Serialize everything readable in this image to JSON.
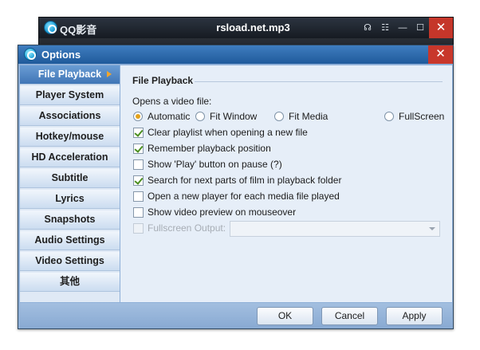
{
  "player": {
    "app_name": "QQ影音",
    "file_name": "rsload.net.mp3",
    "controls": [
      "chat-icon",
      "playlist-icon",
      "minimize-icon",
      "maximize-icon",
      "close-icon"
    ],
    "control_glyphs": [
      "☊",
      "☷",
      "—",
      "☐",
      "✕"
    ]
  },
  "dialog": {
    "title": "Options",
    "close_glyph": "✕"
  },
  "sidebar": {
    "items": [
      {
        "label": "File Playback",
        "active": true
      },
      {
        "label": "Player System"
      },
      {
        "label": "Associations"
      },
      {
        "label": "Hotkey/mouse"
      },
      {
        "label": "HD Acceleration"
      },
      {
        "label": "Subtitle"
      },
      {
        "label": "Lyrics"
      },
      {
        "label": "Snapshots"
      },
      {
        "label": "Audio Settings"
      },
      {
        "label": "Video Settings"
      },
      {
        "label": "其他"
      }
    ]
  },
  "content": {
    "section_title": "File Playback",
    "open_label": "Opens a video file:",
    "open_options": [
      {
        "label": "Automatic",
        "selected": true
      },
      {
        "label": "Fit Window",
        "selected": false
      },
      {
        "label": "Fit Media",
        "selected": false
      },
      {
        "label": "FullScreen",
        "selected": false
      }
    ],
    "checkboxes": [
      {
        "label": "Clear playlist when opening a new file",
        "checked": true
      },
      {
        "label": "Remember playback position",
        "checked": true
      },
      {
        "label": "Show 'Play' button on pause (?)",
        "checked": false
      },
      {
        "label": "Search for next parts of film in playback folder",
        "checked": true
      },
      {
        "label": "Open a new player for each media file played",
        "checked": false
      },
      {
        "label": "Show video preview on mouseover",
        "checked": false
      }
    ],
    "fullscreen_output": {
      "label": "Fullscreen Output:",
      "value": "",
      "disabled": true
    }
  },
  "footer": {
    "ok": "OK",
    "cancel": "Cancel",
    "apply": "Apply"
  },
  "colors": {
    "titlebar": "#2d6aad",
    "active_nav": "#4f84c2",
    "close": "#c8372b",
    "radio_selected": "#e3a21b",
    "check_mark": "#4a8e1f"
  }
}
